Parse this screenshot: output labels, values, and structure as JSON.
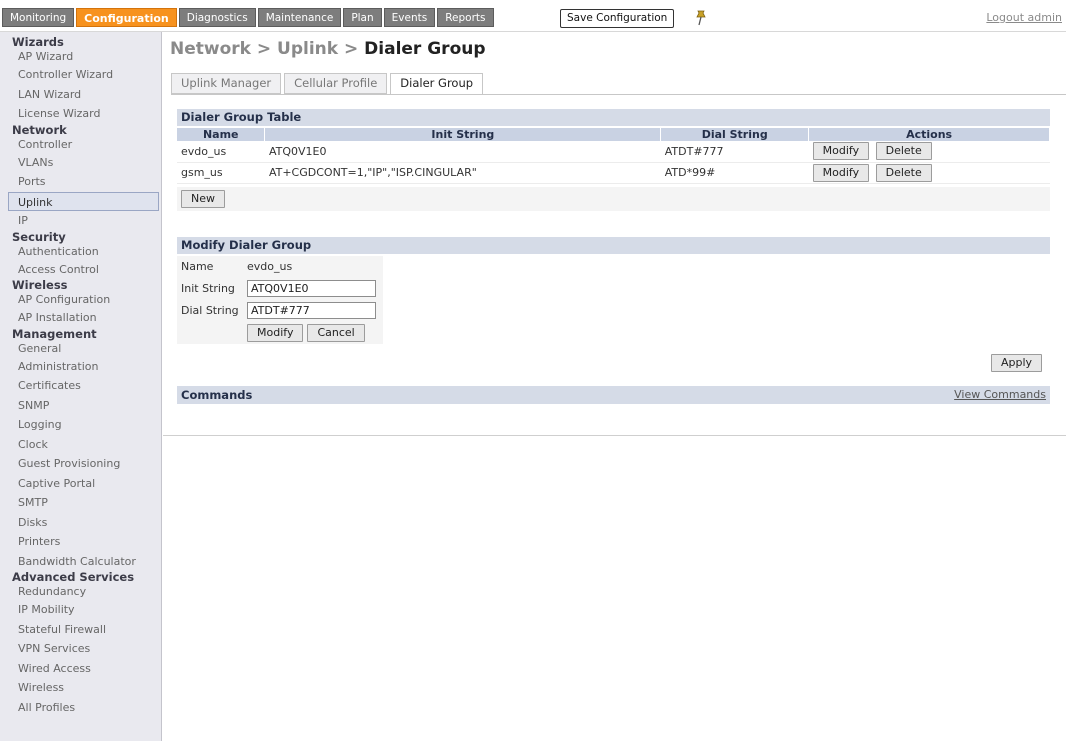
{
  "topnav": {
    "tabs": [
      "Monitoring",
      "Configuration",
      "Diagnostics",
      "Maintenance",
      "Plan",
      "Events",
      "Reports"
    ],
    "active_tab": "Configuration",
    "save_label": "Save Configuration",
    "logout_label": "Logout admin",
    "pin_icon": "pushpin-icon"
  },
  "sidebar": {
    "wizards": "Wizards",
    "ap_wizard": "AP Wizard",
    "controller_wizard": "Controller Wizard",
    "lan_wizard": "LAN Wizard",
    "license_wizard": "License Wizard",
    "network": "Network",
    "controller": "Controller",
    "vlans": "VLANs",
    "ports": "Ports",
    "uplink": "Uplink",
    "ip": "IP",
    "security": "Security",
    "authentication": "Authentication",
    "access_control": "Access Control",
    "wireless_head": "Wireless",
    "ap_configuration": "AP Configuration",
    "ap_installation": "AP Installation",
    "management": "Management",
    "general": "General",
    "administration": "Administration",
    "certificates": "Certificates",
    "snmp": "SNMP",
    "logging": "Logging",
    "clock": "Clock",
    "guest_provisioning": "Guest Provisioning",
    "captive_portal": "Captive Portal",
    "smtp": "SMTP",
    "disks": "Disks",
    "printers": "Printers",
    "bandwidth_calculator": "Bandwidth Calculator",
    "advanced_services": "Advanced Services",
    "redundancy": "Redundancy",
    "ip_mobility": "IP Mobility",
    "stateful_firewall": "Stateful Firewall",
    "vpn_services": "VPN Services",
    "wired_access": "Wired Access",
    "wireless_item": "Wireless",
    "all_profiles": "All Profiles"
  },
  "main": {
    "breadcrumb_prefix": "Network > Uplink > ",
    "breadcrumb_current": "Dialer Group",
    "subtabs": [
      "Uplink Manager",
      "Cellular Profile",
      "Dialer Group"
    ],
    "table_title": "Dialer Group Table",
    "columns": [
      "Name",
      "Init String",
      "Dial String",
      "Actions"
    ],
    "rows": [
      {
        "name": "evdo_us",
        "init": "ATQ0V1E0",
        "dial": "ATDT#777"
      },
      {
        "name": "gsm_us",
        "init": "AT+CGDCONT=1,\"IP\",\"ISP.CINGULAR\"",
        "dial": "ATD*99#"
      }
    ],
    "modify_label": "Modify",
    "delete_label": "Delete",
    "new_label": "New",
    "form_title": "Modify Dialer Group",
    "form": {
      "name_label": "Name",
      "name_value": "evdo_us",
      "init_label": "Init String",
      "init_value": "ATQ0V1E0",
      "dial_label": "Dial String",
      "dial_value": "ATDT#777",
      "modify_label": "Modify",
      "cancel_label": "Cancel"
    },
    "apply_label": "Apply",
    "commands_label": "Commands",
    "view_commands_label": "View Commands"
  }
}
